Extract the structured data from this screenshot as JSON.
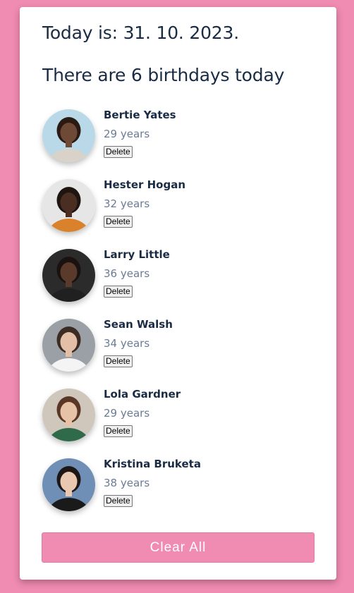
{
  "header": {
    "today_text": "Today is: 31. 10. 2023.",
    "count_text": "There are 6 birthdays today"
  },
  "people": [
    {
      "name": "Bertie Yates",
      "age": "29 years",
      "delete_label": "Delete",
      "photo": {
        "bg": "#b9d9e8",
        "skin": "#6e4a36",
        "hair": "#2a1a12",
        "shirt": "#d9d2c8"
      }
    },
    {
      "name": "Hester Hogan",
      "age": "32 years",
      "delete_label": "Delete",
      "photo": {
        "bg": "#e6e6e6",
        "skin": "#4a2e22",
        "hair": "#1e1410",
        "shirt": "#d9822b"
      }
    },
    {
      "name": "Larry Little",
      "age": "36 years",
      "delete_label": "Delete",
      "photo": {
        "bg": "#2b2b2b",
        "skin": "#5a3a2a",
        "hair": "#1a120e",
        "shirt": "#202020"
      }
    },
    {
      "name": "Sean Walsh",
      "age": "34 years",
      "delete_label": "Delete",
      "photo": {
        "bg": "#9aa0a6",
        "skin": "#e2bfa6",
        "hair": "#3a2c22",
        "shirt": "#f4f4f4"
      }
    },
    {
      "name": "Lola Gardner",
      "age": "29 years",
      "delete_label": "Delete",
      "photo": {
        "bg": "#cfc6bc",
        "skin": "#e8c2a6",
        "hair": "#5a3624",
        "shirt": "#2f6a4a"
      }
    },
    {
      "name": "Kristina Bruketa",
      "age": "38 years",
      "delete_label": "Delete",
      "photo": {
        "bg": "#6f8fb6",
        "skin": "#e9c8b2",
        "hair": "#1c1616",
        "shirt": "#1a1a1a"
      }
    }
  ],
  "actions": {
    "clear_all_label": "Clear All"
  },
  "colors": {
    "page_background": "#f08bb1",
    "card_background": "#ffffff",
    "button_background": "#f08bb1",
    "text_primary": "#1a2b44",
    "text_secondary": "#6a7b93"
  }
}
